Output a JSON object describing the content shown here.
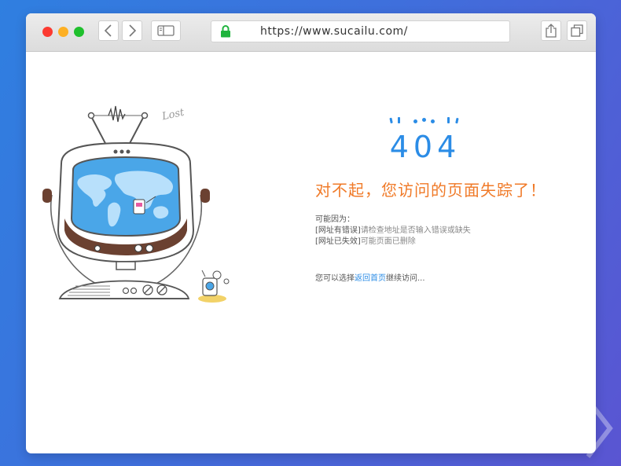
{
  "browser": {
    "url": "https://www.sucailu.com/",
    "buttons": {
      "back": "back-icon",
      "forward": "forward-icon",
      "sidebar": "sidebar-icon",
      "share": "share-icon",
      "tabs": "tabs-icon"
    },
    "lock_icon": "lock-icon",
    "colors": {
      "lock": "#1fb43d",
      "close": "#fc3a31",
      "minimize": "#fdb024",
      "maximize": "#1fc02d"
    }
  },
  "page": {
    "error_code": "404",
    "illustration_text": "Lost",
    "heading": "对不起，您访问的页面失踪了！",
    "reasons_title": "可能因为：",
    "reasons": [
      {
        "tag": "[网址有错误]",
        "desc": "请检查地址是否输入错误或缺失"
      },
      {
        "tag": "[网址已失效]",
        "desc": "可能页面已删除"
      }
    ],
    "choose_prefix": "您可以选择",
    "home_link": "返回首页",
    "choose_suffix": "继续访问...",
    "colors": {
      "accent_blue": "#2b8ce6",
      "heading_orange": "#f07a28"
    }
  }
}
